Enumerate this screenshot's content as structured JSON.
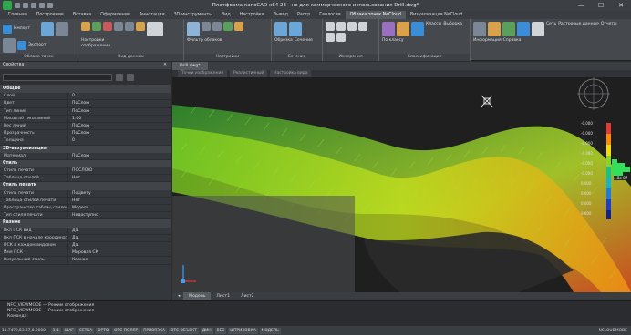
{
  "titlebar": {
    "title": "Платформа nanoCAD x64 23 - не для коммерческого использования Drill.dwg*",
    "minimize": "—",
    "maximize": "☐",
    "close": "✕"
  },
  "tabs": [
    "Главная",
    "Построение",
    "Вставка",
    "Оформление",
    "Аннотации",
    "3D-инструменты",
    "Вид",
    "Настройки",
    "Вывод",
    "Растр",
    "Геология",
    "Облака точек NeCloud",
    "Визуализация NeCloud"
  ],
  "active_tab_index": 11,
  "ribbon": {
    "groups": [
      {
        "label": "Облака точек",
        "items": [
          "Импорт",
          "Экспорт"
        ]
      },
      {
        "label": "Вид данных",
        "items": [
          "Настройки отображения"
        ]
      },
      {
        "label": "Настройки",
        "items": [
          "Фильтр облаков"
        ]
      },
      {
        "label": "Сечения",
        "items": [
          "Обрезка",
          "Сечение"
        ]
      },
      {
        "label": "Измерения",
        "items": []
      },
      {
        "label": "Классификация",
        "items": [
          "Классы",
          "Выборка",
          "По классу"
        ]
      },
      {
        "label": "",
        "items": [
          "Сеть",
          "Растровые данные",
          "Отчеты",
          "Информация",
          "Справка"
        ]
      }
    ]
  },
  "panel": {
    "title": "Свойства",
    "sections": [
      {
        "name": "Общие",
        "rows": [
          [
            "Слой",
            "0"
          ],
          [
            "Цвет",
            "ПоСлою"
          ],
          [
            "Тип линий",
            "ПоСлою"
          ],
          [
            "Масштаб типа линий",
            "1.00"
          ],
          [
            "Вес линий",
            "ПоСлою"
          ],
          [
            "Прозрачность",
            "ПоСлою"
          ],
          [
            "Толщина",
            "0"
          ]
        ]
      },
      {
        "name": "3D-визуализация",
        "rows": [
          [
            "Материал",
            "ПоСлою"
          ]
        ]
      },
      {
        "name": "Стиль",
        "rows": [
          [
            "Стиль печати",
            "ПОСЛОЮ"
          ],
          [
            "Таблица стилей",
            "Нет"
          ]
        ]
      },
      {
        "name": "Стиль печати",
        "rows": [
          [
            "Стиль печати",
            "ПоЦвету"
          ],
          [
            "Таблица стилей печати",
            "Нет"
          ],
          [
            "Пространство таблиц стилей печати",
            "Модель"
          ],
          [
            "Тип стиля печати",
            "Недоступно"
          ]
        ]
      },
      {
        "name": "Разное",
        "rows": [
          [
            "Вкл ПСК вид",
            "Да"
          ],
          [
            "Вкл ПСК в начале координат",
            "Да"
          ],
          [
            "ПСК в каждом видовом",
            "Да"
          ],
          [
            "Имя ПСК",
            "Мировая СК"
          ],
          [
            "Визуальный стиль",
            "Каркас"
          ]
        ]
      }
    ]
  },
  "document": {
    "tab": "Drill.dwg*",
    "view_buttons": [
      "Точки изображения",
      "Реалистичный",
      "Настройка вида"
    ]
  },
  "layout_tabs": [
    "Модель",
    "Лист1",
    "Лист2"
  ],
  "command": {
    "lines": [
      "NFC_VIEWMODE — Режим отображения",
      "NFC_VIEWMODE — Режим отображения",
      "Команда:"
    ]
  },
  "status": {
    "coords": "11.7479,53.67,0.0000",
    "buttons": [
      "1:1",
      "ШАГ",
      "СЕТКА",
      "ОРТО",
      "ОТС-ПОЛЯР",
      "ПРИВЯЗКА",
      "ОТС-ОБЪЕКТ",
      "ДИН",
      "ВЕС",
      "ШТРИХОВКА",
      "МОДЕЛЬ"
    ],
    "right": "NCLOUDMODE"
  },
  "legend": {
    "labels": [
      "-0.000",
      "-0.000",
      "-0.000",
      "-0.000",
      "-0.000",
      "-0.000",
      "0.000",
      "0.000",
      "0.000",
      "0.000"
    ],
    "mid_label": "4.8е-07"
  },
  "colors": {
    "accent": "#f28c28",
    "panel": "#34373b",
    "viewport": "#1f1f20"
  }
}
